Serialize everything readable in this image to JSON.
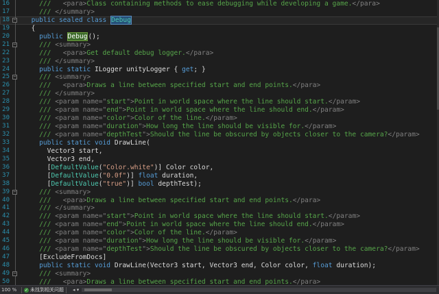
{
  "editor": {
    "lines": [
      {
        "num": "16",
        "indent": "    ",
        "fold": "line",
        "tokens": [
          {
            "c": "c",
            "t": "///   "
          },
          {
            "c": "x",
            "t": "<para>"
          },
          {
            "c": "c",
            "t": "Class containing methods to ease debugging while developing a game."
          },
          {
            "c": "x",
            "t": "</para>"
          }
        ]
      },
      {
        "num": "17",
        "indent": "    ",
        "fold": "line",
        "tokens": [
          {
            "c": "c",
            "t": "/// "
          },
          {
            "c": "x",
            "t": "</summary>"
          }
        ]
      },
      {
        "num": "18",
        "indent": "  ",
        "fold": "box",
        "current": true,
        "tokens": [
          {
            "c": "k",
            "t": "public sealed class "
          },
          {
            "c": "t",
            "t": "Debug",
            "hl": "blue"
          }
        ]
      },
      {
        "num": "19",
        "indent": "  ",
        "fold": "line",
        "tokens": [
          {
            "c": "p",
            "t": "{"
          }
        ]
      },
      {
        "num": "20",
        "indent": "    ",
        "fold": "line",
        "tokens": [
          {
            "c": "k",
            "t": "public "
          },
          {
            "c": "p",
            "t": "Debug",
            "hl": "green"
          },
          {
            "c": "p",
            "t": "();"
          }
        ]
      },
      {
        "num": "21",
        "indent": "    ",
        "fold": "box",
        "tokens": [
          {
            "c": "c",
            "t": "/// "
          },
          {
            "c": "x",
            "t": "<summary>"
          }
        ]
      },
      {
        "num": "22",
        "indent": "    ",
        "fold": "line",
        "tokens": [
          {
            "c": "c",
            "t": "///   "
          },
          {
            "c": "x",
            "t": "<para>"
          },
          {
            "c": "c",
            "t": "Get default debug logger."
          },
          {
            "c": "x",
            "t": "</para>"
          }
        ]
      },
      {
        "num": "23",
        "indent": "    ",
        "fold": "line",
        "tokens": [
          {
            "c": "c",
            "t": "/// "
          },
          {
            "c": "x",
            "t": "</summary>"
          }
        ]
      },
      {
        "num": "24",
        "indent": "    ",
        "fold": "line",
        "tokens": [
          {
            "c": "k",
            "t": "public static "
          },
          {
            "c": "p",
            "t": "ILogger unityLogger { "
          },
          {
            "c": "k",
            "t": "get"
          },
          {
            "c": "p",
            "t": "; }"
          }
        ]
      },
      {
        "num": "25",
        "indent": "    ",
        "fold": "box",
        "tokens": [
          {
            "c": "c",
            "t": "/// "
          },
          {
            "c": "x",
            "t": "<summary>"
          }
        ]
      },
      {
        "num": "26",
        "indent": "    ",
        "fold": "line",
        "tokens": [
          {
            "c": "c",
            "t": "///   "
          },
          {
            "c": "x",
            "t": "<para>"
          },
          {
            "c": "c",
            "t": "Draws a line between specified start and end points."
          },
          {
            "c": "x",
            "t": "</para>"
          }
        ]
      },
      {
        "num": "27",
        "indent": "    ",
        "fold": "line",
        "tokens": [
          {
            "c": "c",
            "t": "/// "
          },
          {
            "c": "x",
            "t": "</summary>"
          }
        ]
      },
      {
        "num": "28",
        "indent": "    ",
        "fold": "line",
        "tokens": [
          {
            "c": "c",
            "t": "/// "
          },
          {
            "c": "x",
            "t": "<param name=\""
          },
          {
            "c": "c",
            "t": "start"
          },
          {
            "c": "x",
            "t": "\">"
          },
          {
            "c": "c",
            "t": "Point in world space where the line should start."
          },
          {
            "c": "x",
            "t": "</param>"
          }
        ]
      },
      {
        "num": "29",
        "indent": "    ",
        "fold": "line",
        "tokens": [
          {
            "c": "c",
            "t": "/// "
          },
          {
            "c": "x",
            "t": "<param name=\""
          },
          {
            "c": "c",
            "t": "end"
          },
          {
            "c": "x",
            "t": "\">"
          },
          {
            "c": "c",
            "t": "Point in world space where the line should end."
          },
          {
            "c": "x",
            "t": "</param>"
          }
        ]
      },
      {
        "num": "30",
        "indent": "    ",
        "fold": "line",
        "tokens": [
          {
            "c": "c",
            "t": "/// "
          },
          {
            "c": "x",
            "t": "<param name=\""
          },
          {
            "c": "c",
            "t": "color"
          },
          {
            "c": "x",
            "t": "\">"
          },
          {
            "c": "c",
            "t": "Color of the line."
          },
          {
            "c": "x",
            "t": "</param>"
          }
        ]
      },
      {
        "num": "31",
        "indent": "    ",
        "fold": "line",
        "tokens": [
          {
            "c": "c",
            "t": "/// "
          },
          {
            "c": "x",
            "t": "<param name=\""
          },
          {
            "c": "c",
            "t": "duration"
          },
          {
            "c": "x",
            "t": "\">"
          },
          {
            "c": "c",
            "t": "How long the line should be visible for."
          },
          {
            "c": "x",
            "t": "</param>"
          }
        ]
      },
      {
        "num": "32",
        "indent": "    ",
        "fold": "line",
        "tokens": [
          {
            "c": "c",
            "t": "/// "
          },
          {
            "c": "x",
            "t": "<param name=\""
          },
          {
            "c": "c",
            "t": "depthTest"
          },
          {
            "c": "x",
            "t": "\">"
          },
          {
            "c": "c",
            "t": "Should the line be obscured by objects closer to the camera?"
          },
          {
            "c": "x",
            "t": "</param>"
          }
        ]
      },
      {
        "num": "33",
        "indent": "    ",
        "fold": "line",
        "tokens": [
          {
            "c": "k",
            "t": "public static void "
          },
          {
            "c": "p",
            "t": "DrawLine("
          }
        ]
      },
      {
        "num": "34",
        "indent": "      ",
        "fold": "line",
        "tokens": [
          {
            "c": "p",
            "t": "Vector3 start,"
          }
        ]
      },
      {
        "num": "35",
        "indent": "      ",
        "fold": "line",
        "tokens": [
          {
            "c": "p",
            "t": "Vector3 end,"
          }
        ]
      },
      {
        "num": "36",
        "indent": "      ",
        "fold": "line",
        "tokens": [
          {
            "c": "p",
            "t": "["
          },
          {
            "c": "t",
            "t": "DefaultValue"
          },
          {
            "c": "p",
            "t": "("
          },
          {
            "c": "s",
            "t": "\"Color.white\""
          },
          {
            "c": "p",
            "t": ")] Color color,"
          }
        ]
      },
      {
        "num": "37",
        "indent": "      ",
        "fold": "line",
        "tokens": [
          {
            "c": "p",
            "t": "["
          },
          {
            "c": "t",
            "t": "DefaultValue"
          },
          {
            "c": "p",
            "t": "("
          },
          {
            "c": "s",
            "t": "\"0.0f\""
          },
          {
            "c": "p",
            "t": ")] "
          },
          {
            "c": "k",
            "t": "float "
          },
          {
            "c": "p",
            "t": "duration,"
          }
        ]
      },
      {
        "num": "38",
        "indent": "      ",
        "fold": "line",
        "tokens": [
          {
            "c": "p",
            "t": "["
          },
          {
            "c": "t",
            "t": "DefaultValue"
          },
          {
            "c": "p",
            "t": "("
          },
          {
            "c": "s",
            "t": "\"true\""
          },
          {
            "c": "p",
            "t": ")] "
          },
          {
            "c": "k",
            "t": "bool "
          },
          {
            "c": "p",
            "t": "depthTest);"
          }
        ]
      },
      {
        "num": "39",
        "indent": "    ",
        "fold": "box",
        "tokens": [
          {
            "c": "c",
            "t": "/// "
          },
          {
            "c": "x",
            "t": "<summary>"
          }
        ]
      },
      {
        "num": "40",
        "indent": "    ",
        "fold": "line",
        "tokens": [
          {
            "c": "c",
            "t": "///   "
          },
          {
            "c": "x",
            "t": "<para>"
          },
          {
            "c": "c",
            "t": "Draws a line between specified start and end points."
          },
          {
            "c": "x",
            "t": "</para>"
          }
        ]
      },
      {
        "num": "41",
        "indent": "    ",
        "fold": "line",
        "tokens": [
          {
            "c": "c",
            "t": "/// "
          },
          {
            "c": "x",
            "t": "</summary>"
          }
        ]
      },
      {
        "num": "42",
        "indent": "    ",
        "fold": "line",
        "tokens": [
          {
            "c": "c",
            "t": "/// "
          },
          {
            "c": "x",
            "t": "<param name=\""
          },
          {
            "c": "c",
            "t": "start"
          },
          {
            "c": "x",
            "t": "\">"
          },
          {
            "c": "c",
            "t": "Point in world space where the line should start."
          },
          {
            "c": "x",
            "t": "</param>"
          }
        ]
      },
      {
        "num": "43",
        "indent": "    ",
        "fold": "line",
        "tokens": [
          {
            "c": "c",
            "t": "/// "
          },
          {
            "c": "x",
            "t": "<param name=\""
          },
          {
            "c": "c",
            "t": "end"
          },
          {
            "c": "x",
            "t": "\">"
          },
          {
            "c": "c",
            "t": "Point in world space where the line should end."
          },
          {
            "c": "x",
            "t": "</param>"
          }
        ]
      },
      {
        "num": "44",
        "indent": "    ",
        "fold": "line",
        "tokens": [
          {
            "c": "c",
            "t": "/// "
          },
          {
            "c": "x",
            "t": "<param name=\""
          },
          {
            "c": "c",
            "t": "color"
          },
          {
            "c": "x",
            "t": "\">"
          },
          {
            "c": "c",
            "t": "Color of the line."
          },
          {
            "c": "x",
            "t": "</param>"
          }
        ]
      },
      {
        "num": "45",
        "indent": "    ",
        "fold": "line",
        "tokens": [
          {
            "c": "c",
            "t": "/// "
          },
          {
            "c": "x",
            "t": "<param name=\""
          },
          {
            "c": "c",
            "t": "duration"
          },
          {
            "c": "x",
            "t": "\">"
          },
          {
            "c": "c",
            "t": "How long the line should be visible for."
          },
          {
            "c": "x",
            "t": "</param>"
          }
        ]
      },
      {
        "num": "46",
        "indent": "    ",
        "fold": "line",
        "tokens": [
          {
            "c": "c",
            "t": "/// "
          },
          {
            "c": "x",
            "t": "<param name=\""
          },
          {
            "c": "c",
            "t": "depthTest"
          },
          {
            "c": "x",
            "t": "\">"
          },
          {
            "c": "c",
            "t": "Should the line be obscured by objects closer to the camera?"
          },
          {
            "c": "x",
            "t": "</param>"
          }
        ]
      },
      {
        "num": "47",
        "indent": "    ",
        "fold": "line",
        "tokens": [
          {
            "c": "p",
            "t": "[ExcludeFromDocs]"
          }
        ]
      },
      {
        "num": "48",
        "indent": "    ",
        "fold": "line",
        "tokens": [
          {
            "c": "k",
            "t": "public static void "
          },
          {
            "c": "p",
            "t": "DrawLine(Vector3 start, Vector3 end, Color color, "
          },
          {
            "c": "k",
            "t": "float "
          },
          {
            "c": "p",
            "t": "duration);"
          }
        ]
      },
      {
        "num": "49",
        "indent": "    ",
        "fold": "box",
        "tokens": [
          {
            "c": "c",
            "t": "/// "
          },
          {
            "c": "x",
            "t": "<summary>"
          }
        ]
      },
      {
        "num": "50",
        "indent": "    ",
        "fold": "line",
        "tokens": [
          {
            "c": "c",
            "t": "///   "
          },
          {
            "c": "x",
            "t": "<para>"
          },
          {
            "c": "c",
            "t": "Draws a line between specified start and end points."
          },
          {
            "c": "x",
            "t": "</para>"
          }
        ]
      }
    ]
  },
  "statusbar": {
    "zoom": "100 %",
    "issues_text": "未找到相关问题",
    "issues_icon": "check-circle-icon"
  },
  "colors": {
    "background": "#1e1e1e",
    "line_number": "#2b91af",
    "keyword": "#569cd6",
    "type": "#4ec9b0",
    "comment": "#57a64a",
    "xml_tag": "#808080",
    "string": "#d69d85",
    "identifier_highlight": "#3d6b2b",
    "selection_highlight": "#264f78"
  }
}
